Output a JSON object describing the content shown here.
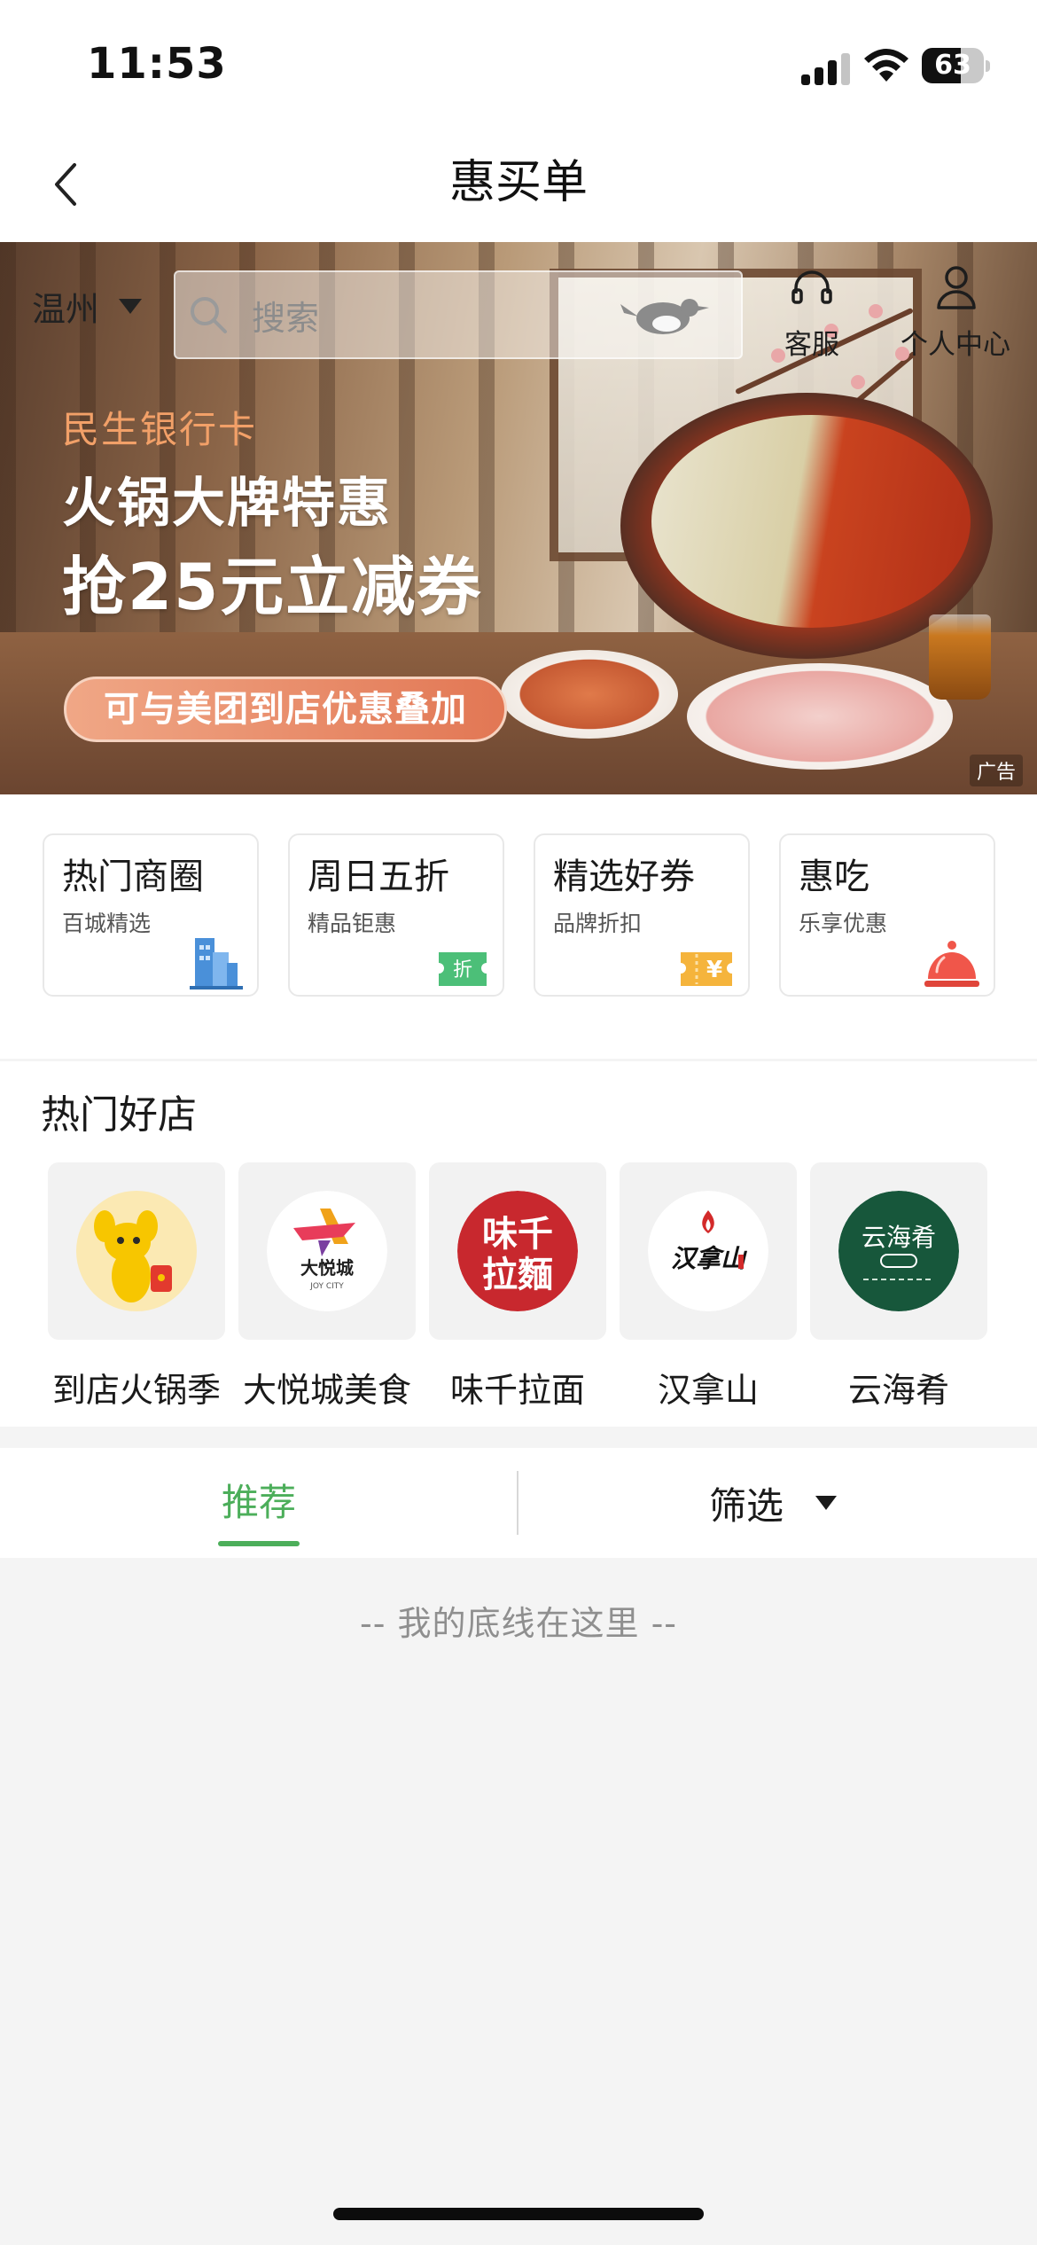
{
  "status_bar": {
    "time": "11:53",
    "battery": "63",
    "battery_level": 0.63
  },
  "nav": {
    "title": "惠买单"
  },
  "banner": {
    "city": "温州",
    "search_placeholder": "搜索",
    "service_label": "客服",
    "profile_label": "个人中心",
    "promo_subtitle": "民生银行卡",
    "promo_title_line1": "火锅大牌特惠",
    "promo_title_line2": "抢25元立减券",
    "promo_pill": "可与美团到店优惠叠加",
    "ad_tag": "广告"
  },
  "categories": [
    {
      "title": "热门商圈",
      "subtitle": "百城精选",
      "icon": "building-icon"
    },
    {
      "title": "周日五折",
      "subtitle": "精品钜惠",
      "icon": "discount-tag-icon",
      "icon_text": "折"
    },
    {
      "title": "精选好券",
      "subtitle": "品牌折扣",
      "icon": "coupon-icon",
      "icon_text": "¥"
    },
    {
      "title": "惠吃",
      "subtitle": "乐享优惠",
      "icon": "food-cloche-icon"
    }
  ],
  "hot_shops": {
    "title": "热门好店",
    "items": [
      {
        "name": "到店火锅季",
        "logo": "mascot-logo"
      },
      {
        "name": "大悦城美食",
        "logo": "joy-city-logo",
        "logo_text": "大悦城",
        "logo_sub": "JOY CITY"
      },
      {
        "name": "味千拉面",
        "logo": "ajisen-logo",
        "logo_text": "味千拉麵"
      },
      {
        "name": "汉拿山",
        "logo": "hannashan-logo",
        "logo_text": "汉拿山"
      },
      {
        "name": "云海肴",
        "logo": "yunhaiyao-logo",
        "logo_text": "云海肴"
      }
    ]
  },
  "tabs": {
    "recommend": "推荐",
    "filter": "筛选"
  },
  "footer": {
    "bottom_line": "-- 我的底线在这里 --"
  },
  "colors": {
    "accent": "#4cae5a",
    "background": "#f4f4f4"
  }
}
